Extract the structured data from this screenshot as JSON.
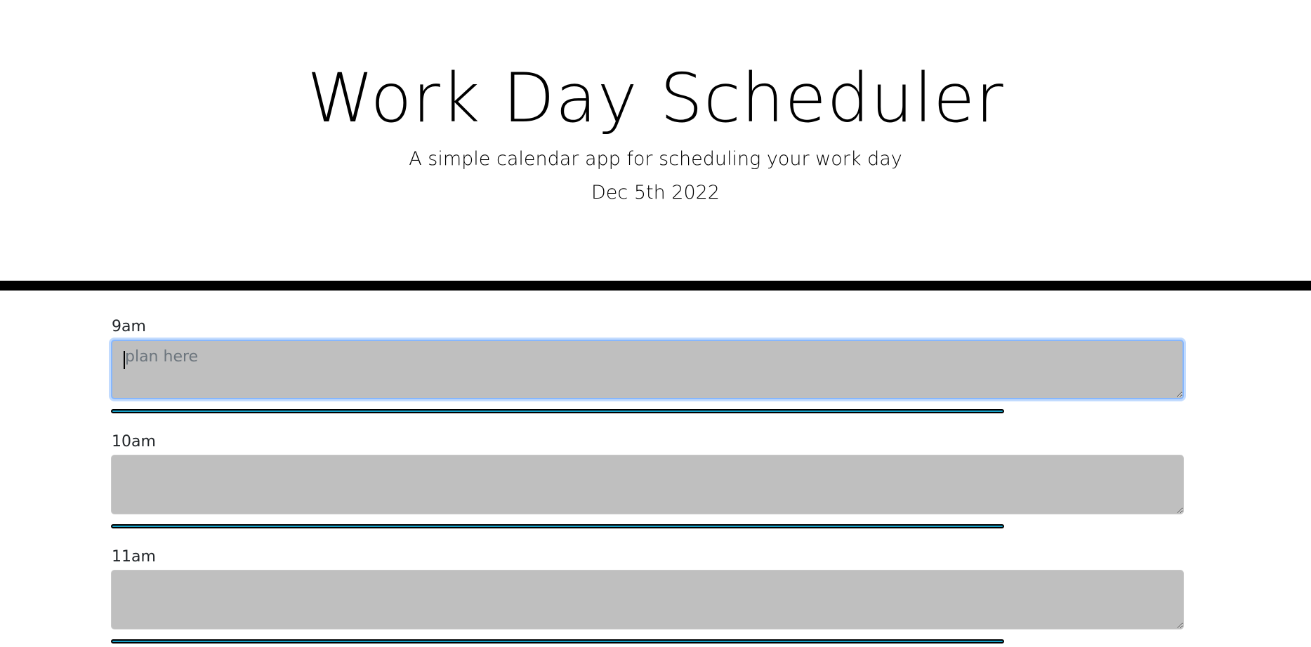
{
  "header": {
    "title": "Work Day Scheduler",
    "lead": "A simple calendar app for scheduling your work day",
    "date": "Dec 5th 2022"
  },
  "hours": [
    {
      "label": "9am",
      "placeholder": "plan here",
      "value": "",
      "focused": true
    },
    {
      "label": "10am",
      "placeholder": "",
      "value": "",
      "focused": false
    },
    {
      "label": "11am",
      "placeholder": "",
      "value": "",
      "focused": false
    }
  ],
  "colors": {
    "input_background": "#bfbfbf",
    "save_button": "#17a2c9",
    "header_divider": "#000000",
    "focus_ring": "#86b7fe"
  }
}
